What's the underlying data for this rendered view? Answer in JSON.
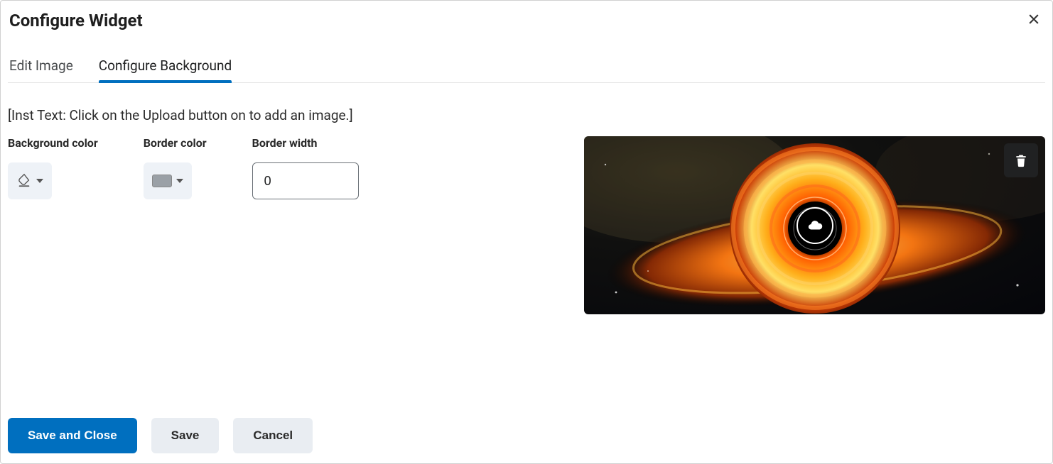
{
  "dialog": {
    "title": "Configure Widget"
  },
  "tabs": {
    "edit_image": "Edit Image",
    "configure_background": "Configure Background"
  },
  "instructions": "[Inst Text: Click on the Upload button on to add an image.]",
  "fields": {
    "background_color": {
      "label": "Background color"
    },
    "border_color": {
      "label": "Border color",
      "swatch": "#9aa0a6"
    },
    "border_width": {
      "label": "Border width",
      "value": "0"
    }
  },
  "buttons": {
    "save_close": "Save and Close",
    "save": "Save",
    "cancel": "Cancel"
  },
  "icons": {
    "close": "close-icon",
    "fill": "fill-icon",
    "caret": "chevron-down-icon",
    "upload": "upload-cloud-icon",
    "delete": "trash-icon"
  }
}
